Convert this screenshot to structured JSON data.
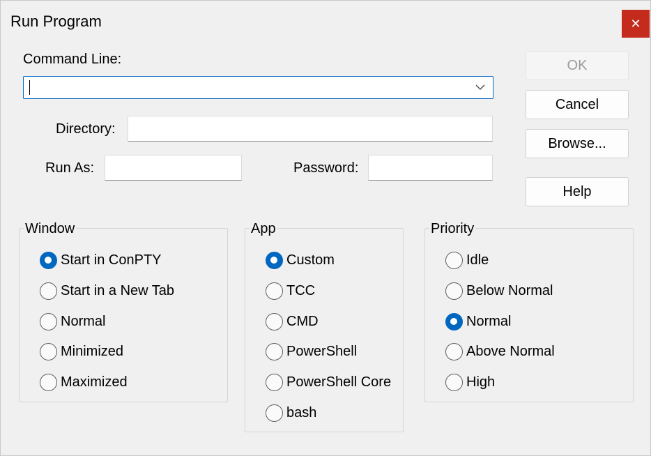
{
  "window": {
    "title": "Run Program",
    "close_glyph": "✕"
  },
  "fields": {
    "command_line_label": "Command Line:",
    "command_line_value": "",
    "directory_label": "Directory:",
    "directory_value": "",
    "run_as_label": "Run As:",
    "run_as_value": "",
    "password_label": "Password:",
    "password_value": ""
  },
  "buttons": {
    "ok": "OK",
    "cancel": "Cancel",
    "browse": "Browse...",
    "help": "Help"
  },
  "groups": {
    "window": {
      "title": "Window",
      "options": [
        "Start in ConPTY",
        "Start in a New Tab",
        "Normal",
        "Minimized",
        "Maximized"
      ],
      "selected": "Start in ConPTY"
    },
    "app": {
      "title": "App",
      "options": [
        "Custom",
        "TCC",
        "CMD",
        "PowerShell",
        "PowerShell Core",
        "bash"
      ],
      "selected": "Custom"
    },
    "priority": {
      "title": "Priority",
      "options": [
        "Idle",
        "Below Normal",
        "Normal",
        "Above Normal",
        "High"
      ],
      "selected": "Normal"
    }
  },
  "colors": {
    "accent": "#0067c0",
    "close_button": "#c42b1c",
    "background": "#f0f0f0"
  },
  "icons": {
    "close": "close-icon",
    "dropdown": "chevron-down-icon"
  }
}
